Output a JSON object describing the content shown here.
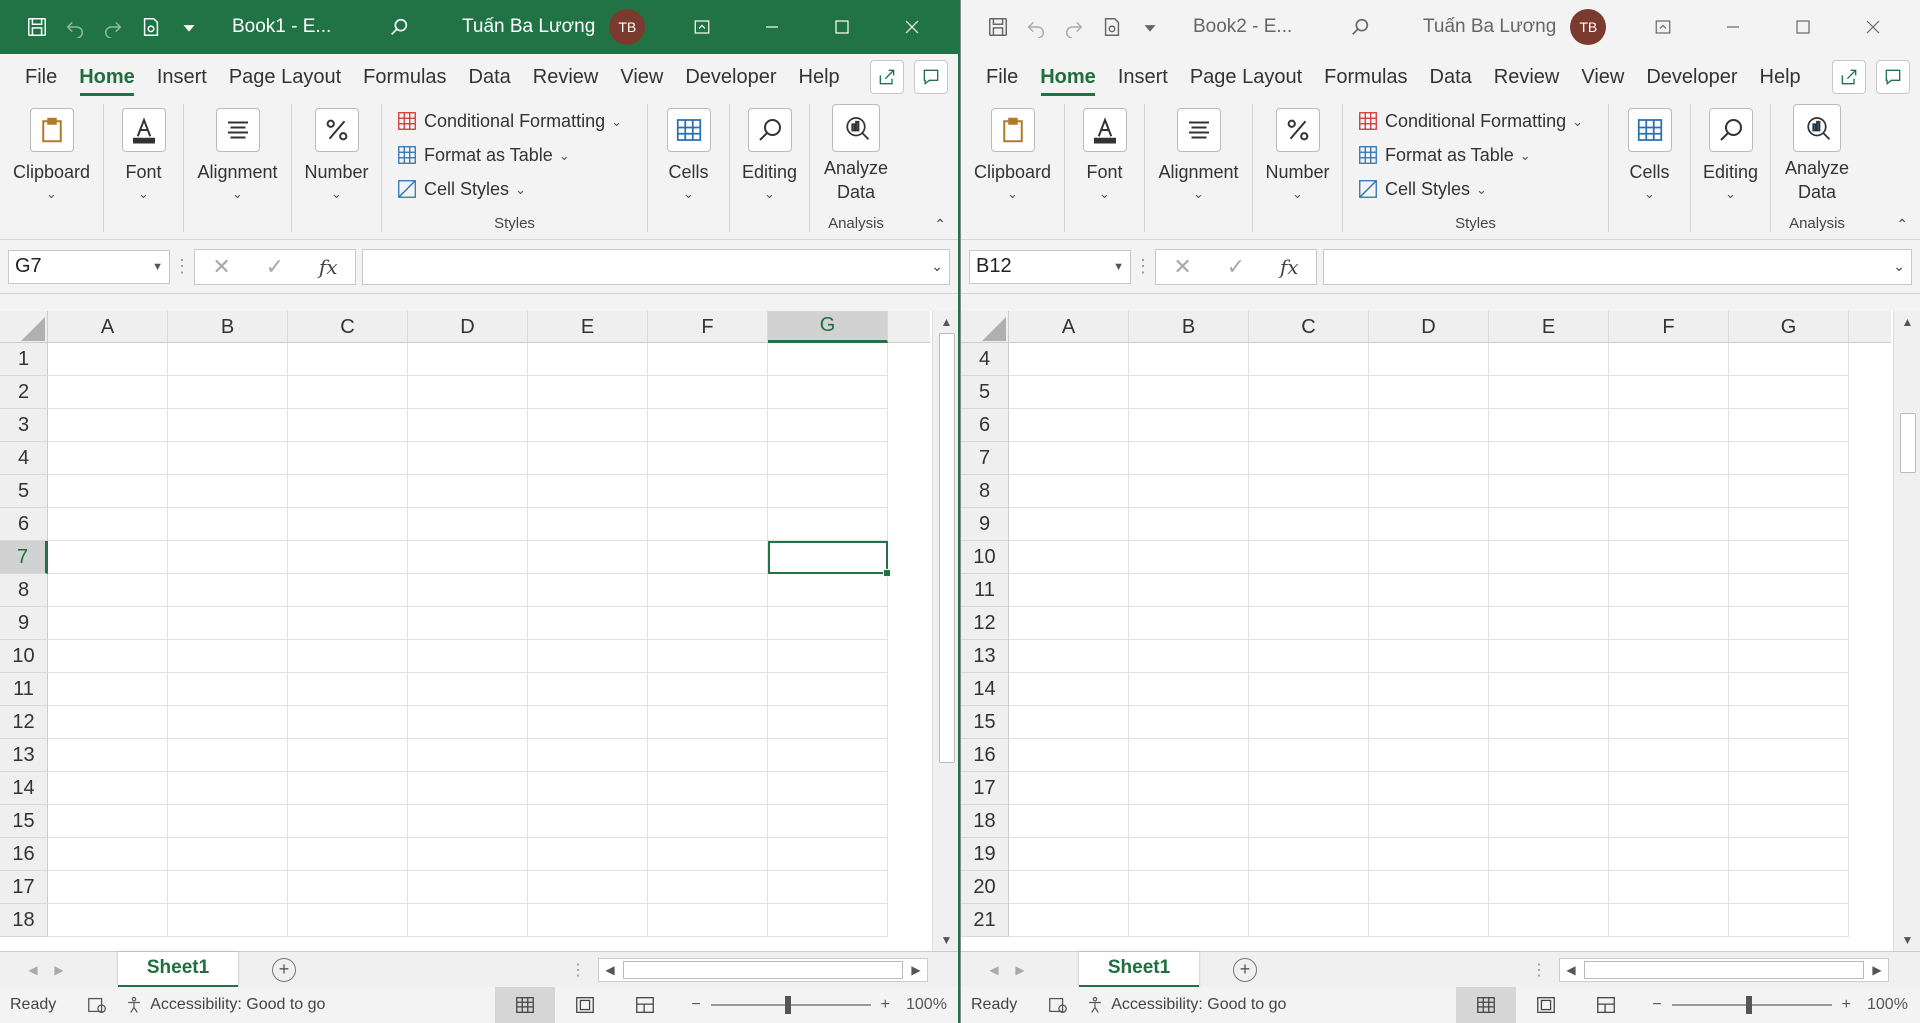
{
  "windows": [
    {
      "id": "book1",
      "title": "Book1  -  E...",
      "user": "Tuấn Ba Lương",
      "initials": "TB",
      "tabs": [
        "File",
        "Home",
        "Insert",
        "Page Layout",
        "Formulas",
        "Data",
        "Review",
        "View",
        "Developer",
        "Help"
      ],
      "active_tab": "Home",
      "ribbon": {
        "clipboard": "Clipboard",
        "font": "Font",
        "alignment": "Alignment",
        "number": "Number",
        "conditional_formatting": "Conditional Formatting",
        "format_as_table": "Format as Table",
        "cell_styles": "Cell Styles",
        "styles_group": "Styles",
        "cells": "Cells",
        "editing": "Editing",
        "analyze_line1": "Analyze",
        "analyze_line2": "Data",
        "analysis_group": "Analysis"
      },
      "name_box": "G7",
      "formula": "",
      "columns": [
        "A",
        "B",
        "C",
        "D",
        "E",
        "F",
        "G"
      ],
      "selected_col": "G",
      "rows": [
        1,
        2,
        3,
        4,
        5,
        6,
        7,
        8,
        9,
        10,
        11,
        12,
        13,
        14,
        15,
        16,
        17,
        18
      ],
      "selected_row": 7,
      "active_cell": {
        "col": "G",
        "row": 7
      },
      "sheet_tab": "Sheet1",
      "status": {
        "ready": "Ready",
        "accessibility": "Accessibility: Good to go",
        "zoom": "100%",
        "zoom_minus": "−",
        "zoom_plus": "+"
      },
      "vscroll_position": 0.0
    },
    {
      "id": "book2",
      "title": "Book2  -  E...",
      "user": "Tuấn Ba Lương",
      "initials": "TB",
      "tabs": [
        "File",
        "Home",
        "Insert",
        "Page Layout",
        "Formulas",
        "Data",
        "Review",
        "View",
        "Developer",
        "Help"
      ],
      "active_tab": "Home",
      "ribbon": {
        "clipboard": "Clipboard",
        "font": "Font",
        "alignment": "Alignment",
        "number": "Number",
        "conditional_formatting": "Conditional Formatting",
        "format_as_table": "Format as Table",
        "cell_styles": "Cell Styles",
        "styles_group": "Styles",
        "cells": "Cells",
        "editing": "Editing",
        "analyze_line1": "Analyze",
        "analyze_line2": "Data",
        "analysis_group": "Analysis"
      },
      "name_box": "B12",
      "formula": "",
      "columns": [
        "A",
        "B",
        "C",
        "D",
        "E",
        "F",
        "G"
      ],
      "selected_col": "",
      "rows": [
        4,
        5,
        6,
        7,
        8,
        9,
        10,
        11,
        12,
        13,
        14,
        15,
        16,
        17,
        18,
        19,
        20,
        21
      ],
      "selected_row": 0,
      "active_cell": null,
      "sheet_tab": "Sheet1",
      "status": {
        "ready": "Ready",
        "accessibility": "Accessibility: Good to go",
        "zoom": "100%",
        "zoom_minus": "−",
        "zoom_plus": "+"
      },
      "vscroll_position": 0.15
    }
  ],
  "colors": {
    "accent": "#217346",
    "avatar": "#7a3b2e"
  }
}
